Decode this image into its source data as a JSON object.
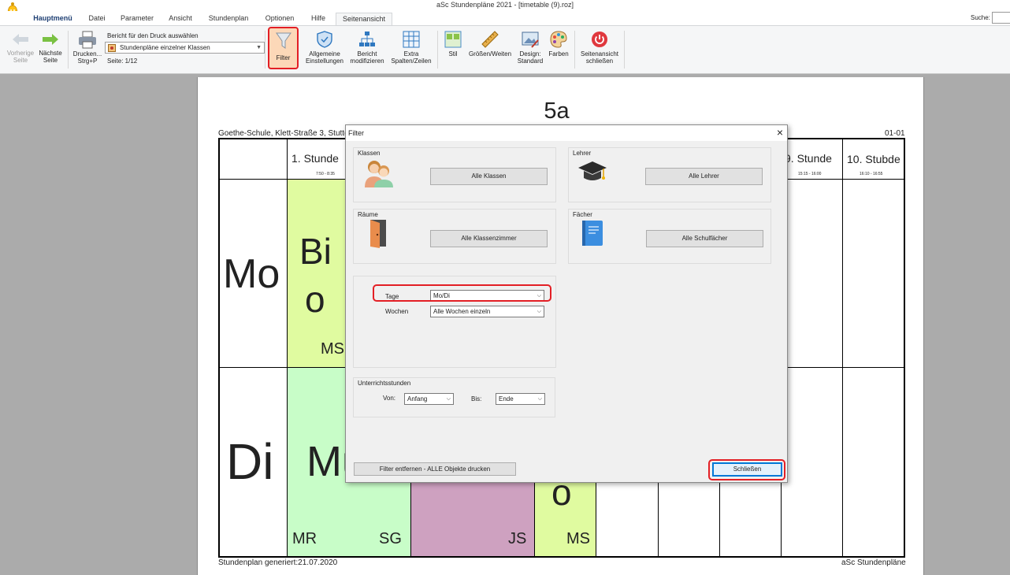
{
  "window": {
    "title": "aSc Stundenpläne 2021  - [timetable (9).roz]"
  },
  "menu": {
    "tabs": [
      "Hauptmenü",
      "Datei",
      "Parameter",
      "Ansicht",
      "Stundenplan",
      "Optionen",
      "Hilfe",
      "Seitenansicht"
    ],
    "active": "Seitenansicht",
    "search_label": "Suche:"
  },
  "ribbon": {
    "prev_label_1": "Vorherige",
    "prev_label_2": "Seite",
    "next_label_1": "Nächste",
    "next_label_2": "Seite",
    "print_label_1": "Drucken...",
    "print_label_2": "Strg+P",
    "report_title": "Bericht für den Druck auswählen",
    "report_value": "Stundenpläne einzelner Klassen",
    "page_indicator": "Seite: 1/12",
    "filter_label": "Filter",
    "general_label_1": "Allgemeine",
    "general_label_2": "Einstellungen",
    "modify_label_1": "Bericht",
    "modify_label_2": "modifizieren",
    "extra_label_1": "Extra",
    "extra_label_2": "Spalten/Zeilen",
    "style_label": "Stil",
    "sizes_label": "Größen/Weiten",
    "design_label_1": "Design:",
    "design_label_2": "Standard",
    "colors_label": "Farben",
    "close_preview_label_1": "Seitenansicht",
    "close_preview_label_2": "schließen"
  },
  "page": {
    "class_title": "5a",
    "school": "Goethe-Schule, Klett-Straße 3, Stuttgart",
    "code": "01-01",
    "footer_left": "Stundenplan generiert:21.07.2020",
    "footer_right": "aSc Stundenpläne",
    "hour1": "1. Stunde",
    "hour1_time": "7:50 - 8:35",
    "hour9": "9. Stunde",
    "hour9_time": "15:15 - 16:00",
    "hour10": "10. Stubde",
    "hour10_time": "16:10 - 16:55",
    "day_mo": "Mo",
    "day_di": "Di",
    "mo_subject_1": "Bi",
    "mo_subject_2": "o",
    "mo_teacher": "MS",
    "di_subject": "Mu",
    "di_teacher_1": "MR",
    "di_teacher_2": "SG",
    "di_teacher_3": "JS",
    "di_subject_3": "o",
    "di_teacher_4": "MS",
    "colors": {
      "green_light": "#e0fba0",
      "mint": "#c8fdc8",
      "mauve": "#cea1c0"
    }
  },
  "dialog": {
    "title": "Filter",
    "classes_group": "Klassen",
    "classes_button": "Alle Klassen",
    "teachers_group": "Lehrer",
    "teachers_button": "Alle Lehrer",
    "rooms_group": "Räume",
    "rooms_button": "Alle Klassenzimmer",
    "subjects_group": "Fächer",
    "subjects_button": "Alle Schulfächer",
    "days_label": "Tage",
    "days_value": "Mo/Di",
    "weeks_label": "Wochen",
    "weeks_value": "Alle Wochen einzeln",
    "lessons_group": "Unterrichtsstunden",
    "from_label": "Von:",
    "from_value": "Anfang",
    "to_label": "Bis:",
    "to_value": "Ende",
    "remove_filter_button": "Filter entfernen - ALLE  Objekte drucken",
    "close_button": "Schließen"
  }
}
